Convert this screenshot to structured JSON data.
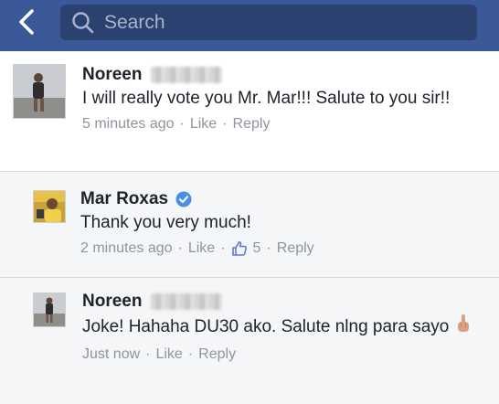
{
  "header": {
    "search_placeholder": "Search"
  },
  "comments": [
    {
      "name": "Noreen",
      "text": "I will really vote you Mr. Mar!!! Salute to you sir!!",
      "time": "5 minutes ago",
      "like_label": "Like",
      "reply_label": "Reply"
    },
    {
      "name": "Mar Roxas",
      "text": "Thank you very much!",
      "time": "2 minutes ago",
      "like_label": "Like",
      "like_count": "5",
      "reply_label": "Reply"
    },
    {
      "name": "Noreen",
      "text": "Joke! Hahaha DU30 ako. Salute nlng para sayo",
      "time": "Just now",
      "like_label": "Like",
      "reply_label": "Reply"
    }
  ],
  "colors": {
    "header": "#3b5998",
    "verified": "#4a90e2",
    "like": "#5b7bd5"
  }
}
